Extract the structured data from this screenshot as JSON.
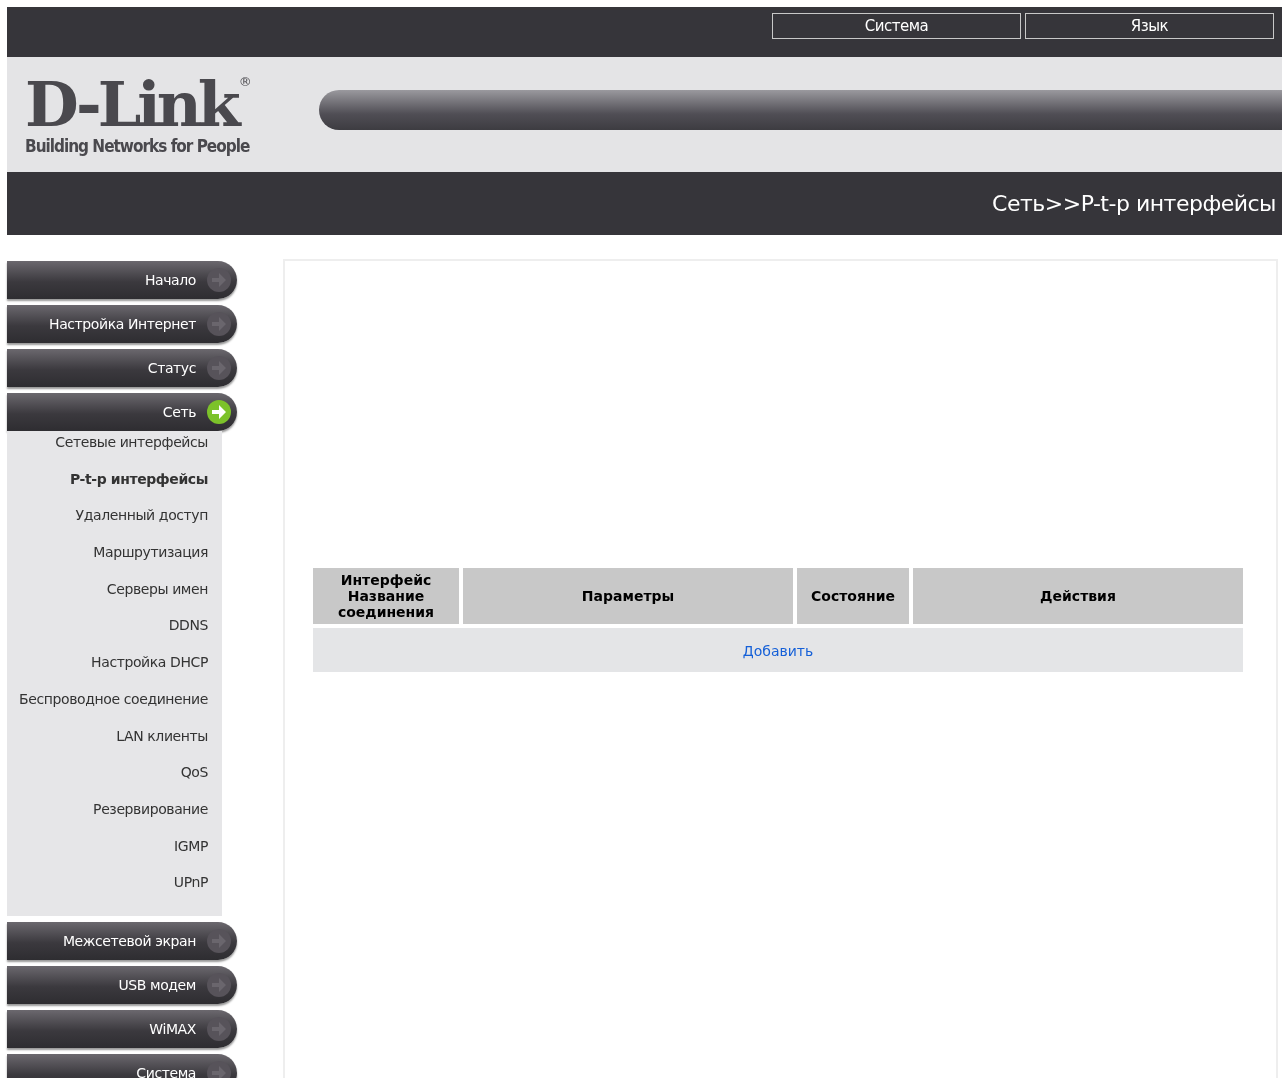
{
  "top_bar": {
    "buttons": [
      "Система",
      "Язык"
    ]
  },
  "logo": {
    "name": "D-Link",
    "mark": "®",
    "tagline": "Building Networks for People"
  },
  "breadcrumb": "Сеть>>P-t-p интерфейсы",
  "nav": [
    {
      "label": "Начало",
      "selected": false
    },
    {
      "label": "Настройка Интернет",
      "selected": false
    },
    {
      "label": "Статус",
      "selected": false
    },
    {
      "label": "Сеть",
      "selected": true,
      "children": [
        {
          "label": "Сетевые интерфейсы",
          "selected": false
        },
        {
          "label": "P-t-p интерфейсы",
          "selected": true
        },
        {
          "label": "Удаленный доступ",
          "selected": false
        },
        {
          "label": "Маршрутизация",
          "selected": false
        },
        {
          "label": "Серверы имен",
          "selected": false
        },
        {
          "label": "DDNS",
          "selected": false
        },
        {
          "label": "Настройка DHCP",
          "selected": false
        },
        {
          "label": "Беспроводное соединение",
          "selected": false
        },
        {
          "label": "LAN клиенты",
          "selected": false
        },
        {
          "label": "QoS",
          "selected": false
        },
        {
          "label": "Резервирование",
          "selected": false
        },
        {
          "label": "IGMP",
          "selected": false
        },
        {
          "label": "UPnP",
          "selected": false
        }
      ]
    },
    {
      "label": "Межсетевой экран",
      "selected": false
    },
    {
      "label": "USB модем",
      "selected": false
    },
    {
      "label": "WiMAX",
      "selected": false
    },
    {
      "label": "Система",
      "selected": false
    }
  ],
  "table": {
    "columns": [
      "Интерфейс Название соединения",
      "Параметры",
      "Состояние",
      "Действия"
    ],
    "add_link": "Добавить"
  }
}
